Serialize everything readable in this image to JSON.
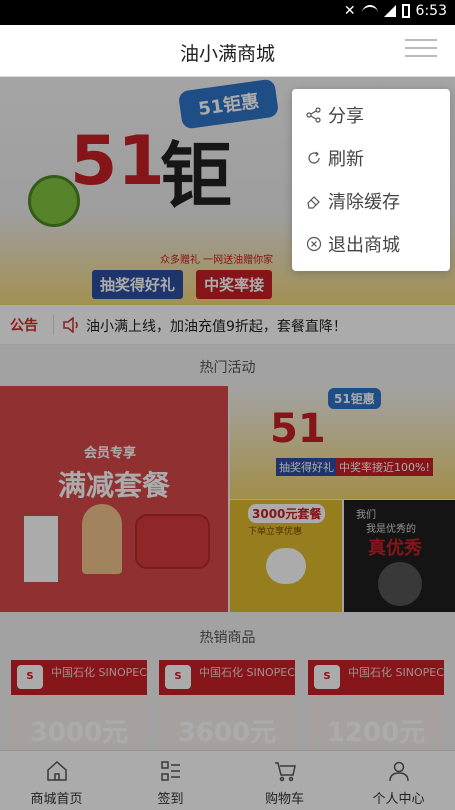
{
  "status_bar": {
    "time": "6:53",
    "icons": [
      "mute-icon",
      "wifi-icon",
      "signal-icon",
      "battery-icon"
    ]
  },
  "header": {
    "title": "油小满商城",
    "menu_icon": "hamburger-menu-icon"
  },
  "banner": {
    "badge": "51钜惠",
    "big_text": "51钜惠",
    "subtext_1": "抽奖得好礼",
    "subtext_2": "中奖率接",
    "small_tag": "众多赠礼 一网送油赠你家"
  },
  "notice": {
    "label": "公告",
    "text": "油小满上线，加油充值9折起，套餐直降！"
  },
  "sections": {
    "hot_activities": "热门活动",
    "hot_products": "热销商品"
  },
  "activities": {
    "member_tag": "会员专享",
    "member_title": "满减套餐",
    "promo_small": "51钜惠",
    "promo_sub_1": "抽奖得好礼",
    "promo_sub_2": "中奖率接近100%!",
    "coupon_title": "3000元套餐",
    "coupon_small": "下单立享优惠",
    "show_line_1": "我们",
    "show_line_2": "我是优秀的",
    "show_title": "真优秀"
  },
  "products": [
    {
      "brand": "中国石化 SINOPEC",
      "price": "3000元"
    },
    {
      "brand": "中国石化 SINOPEC",
      "price": "3600元"
    },
    {
      "brand": "中国石化 SINOPEC",
      "price": "1200元"
    }
  ],
  "menu": {
    "items": [
      {
        "label": "分享",
        "icon": "share-icon"
      },
      {
        "label": "刷新",
        "icon": "refresh-icon"
      },
      {
        "label": "清除缓存",
        "icon": "eraser-icon"
      },
      {
        "label": "退出商城",
        "icon": "close-circle-icon"
      }
    ]
  },
  "tabbar": {
    "items": [
      {
        "label": "商城首页",
        "icon": "home-icon"
      },
      {
        "label": "签到",
        "icon": "checkin-list-icon"
      },
      {
        "label": "购物车",
        "icon": "cart-icon"
      },
      {
        "label": "个人中心",
        "icon": "user-icon"
      }
    ]
  }
}
